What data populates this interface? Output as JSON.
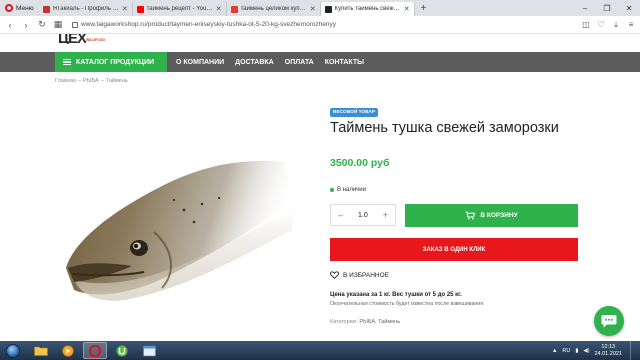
{
  "browser": {
    "menu_label": "Меню",
    "tabs": [
      {
        "title": "ЯТакиаль - Профиль пол...",
        "fav_color": "#c73030"
      },
      {
        "title": "таймень рецепт - YouTube",
        "fav_color": "#ff0000"
      },
      {
        "title": "таймень целиком купить",
        "fav_color": "#e33b2e"
      },
      {
        "title": "Купить таймень свежемо",
        "fav_color": "#222222"
      }
    ],
    "new_tab": "+",
    "url": "www.taigaworkshop.ru/product/taymen-eniseyskiy-tushka-ot-5-20-kg-svezhemorozhenyy"
  },
  "site": {
    "logo": "ЦЕХ",
    "logo_sub": "WILDFOOD",
    "catalog_label": "КАТАЛОГ ПРОДУКЦИИ",
    "nav": [
      "О КОМПАНИИ",
      "ДОСТАВКА",
      "ОПЛАТА",
      "КОНТАКТЫ"
    ],
    "breadcrumb": [
      "Главная",
      "РЫБА",
      "Таймень"
    ],
    "breadcrumb_sep": "–"
  },
  "product": {
    "badge": "ВЕСОВОЙ ТОВАР",
    "title": "Таймень тушка свежей заморозки",
    "price": "3500.00 руб",
    "stock": "В наличии",
    "qty": "1.0",
    "qty_minus": "–",
    "qty_plus": "+",
    "cart_label": "В КОРЗИНУ",
    "oneclick_label": "ЗАКАЗ В ОДИН КЛИК",
    "favorite_label": "В ИЗБРАННОЕ",
    "weight_note": "Цена указана за 1 кг. Вес тушки от 5 до 25 кг.",
    "final_note": "Окончательная стоимость будет известна после взвешивания.",
    "category_label": "Категории:",
    "categories": "РЫБА, Таймень"
  },
  "taskbar": {
    "lang": "RU",
    "time": "12:13",
    "date": "24.01.2021"
  },
  "colors": {
    "green": "#2fb24c",
    "red": "#e7171c",
    "nav_gray": "#5c5c5c",
    "badge_blue": "#3b8fd7"
  }
}
